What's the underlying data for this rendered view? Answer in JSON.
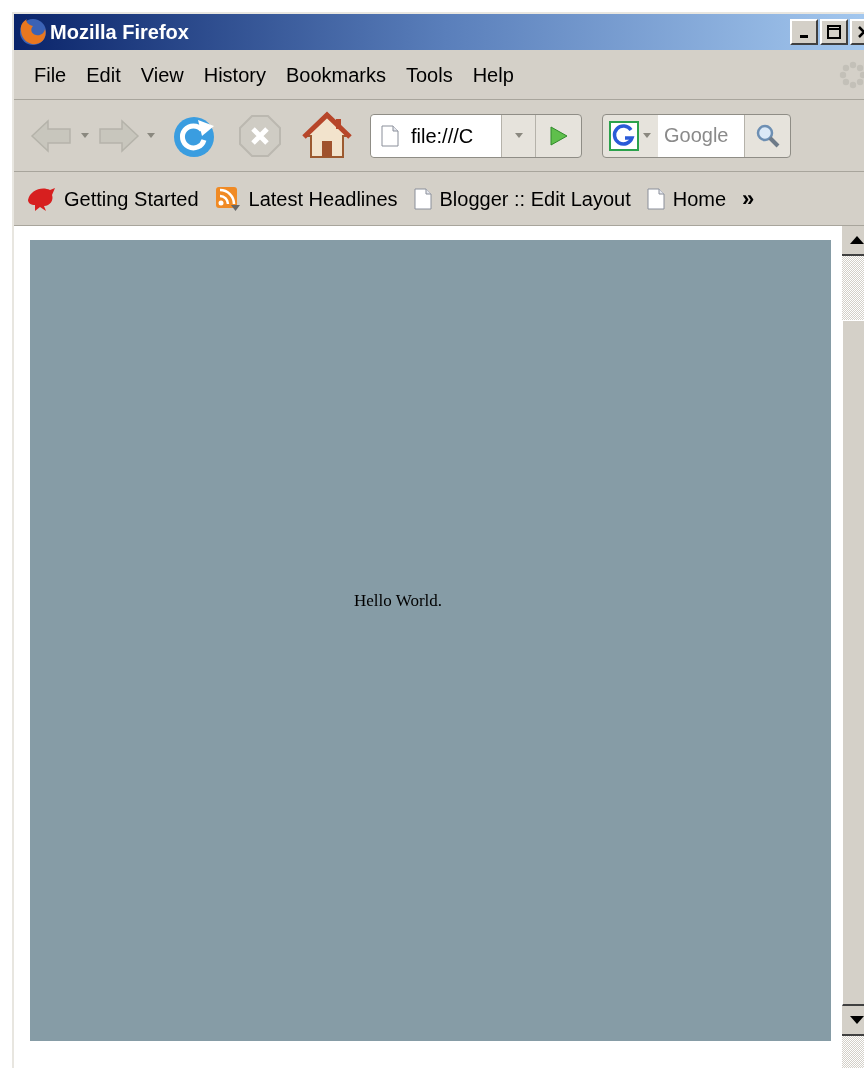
{
  "window": {
    "title": "Mozilla Firefox"
  },
  "menu": [
    "File",
    "Edit",
    "View",
    "History",
    "Bookmarks",
    "Tools",
    "Help"
  ],
  "toolbar": {
    "back_disabled": true,
    "forward_disabled": true,
    "stop_disabled": true,
    "address": "file:///C",
    "search_placeholder": "Google"
  },
  "bookmarks": [
    {
      "label": "Getting Started",
      "kind": "start"
    },
    {
      "label": "Latest Headlines",
      "kind": "feed"
    },
    {
      "label": "Blogger :: Edit Layout",
      "kind": "page"
    },
    {
      "label": "Home",
      "kind": "page"
    }
  ],
  "bookmarks_overflow": "»",
  "page": {
    "text": "Hello World."
  }
}
